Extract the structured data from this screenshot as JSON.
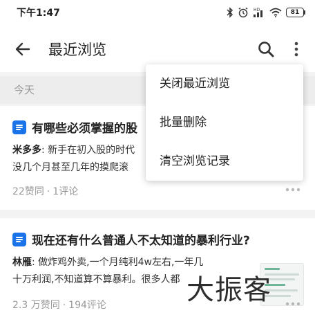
{
  "status_bar": {
    "time": "下午1:47",
    "icons": [
      "bluetooth-icon",
      "alarm-icon",
      "hd-signal-icon",
      "wifi-icon",
      "battery-icon"
    ],
    "battery_level": "81"
  },
  "app_bar": {
    "title": "最近浏览",
    "icons": [
      "back-arrow-icon",
      "search-icon",
      "more-vert-icon"
    ]
  },
  "list": {
    "section_label": "今天",
    "items": [
      {
        "title": "有哪些必须掌握的股",
        "author": "米多多",
        "excerpt_line1": ": 新手在初入股的时代",
        "excerpt_line2": "没几个月甚至几年的摸爬滚",
        "likes": "22赞同",
        "separator": "·",
        "comments": "1评论"
      },
      {
        "title": "现在还有什么普通人不太知道的暴利行业?",
        "author": "林雁",
        "excerpt_line1": ": 做炸鸡外卖,一个月纯利4w左右,一年几",
        "excerpt_line2": "十万利润,不知道算不算暴利。很多人都",
        "likes": "2.3 万赞同",
        "separator": "·",
        "comments": "194评论"
      }
    ]
  },
  "menu": {
    "items": [
      "关闭最近浏览",
      "批量删除",
      "清空浏览记录"
    ]
  },
  "watermark": {
    "text": "大振客"
  },
  "colors": {
    "accent_blue": "#1a73e8",
    "secondary_text": "#999999",
    "list_background": "#f3f3f3"
  }
}
